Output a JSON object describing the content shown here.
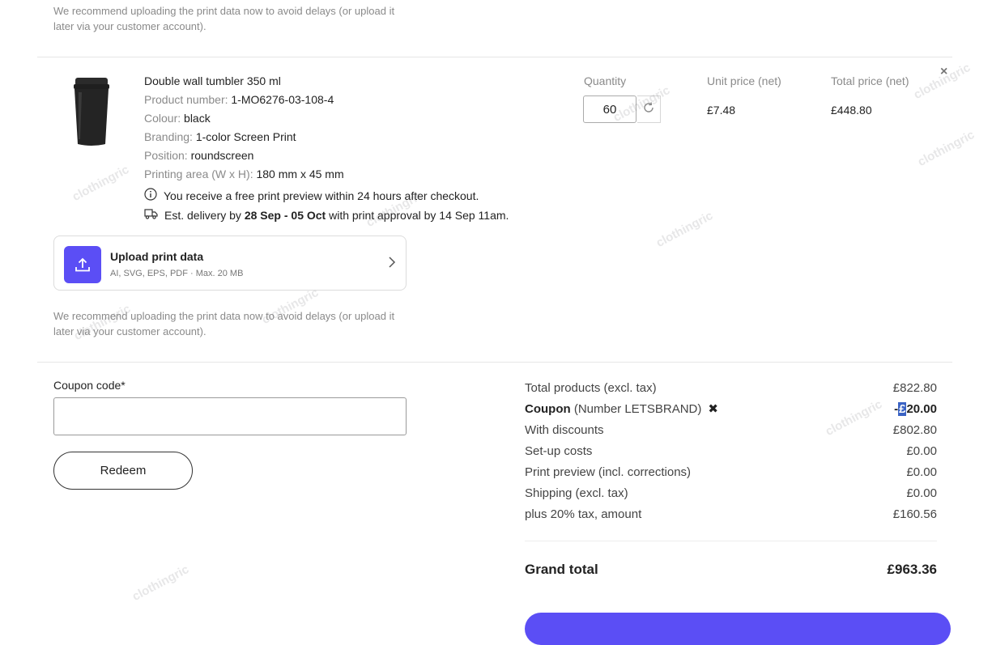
{
  "top_note": "We recommend uploading the print data now to avoid delays (or upload it later via your customer account).",
  "product": {
    "title": "Double wall tumbler 350 ml",
    "specs": [
      {
        "label": "Product number:",
        "value": "1-MO6276-03-108-4"
      },
      {
        "label": "Colour:",
        "value": "black"
      },
      {
        "label": "Branding:",
        "value": "1-color Screen Print"
      },
      {
        "label": "Position:",
        "value": "roundscreen"
      },
      {
        "label": "Printing area (W x H):",
        "value": "180 mm x 45 mm"
      }
    ],
    "preview_info": "You receive a free print preview within 24 hours after checkout.",
    "delivery": {
      "prefix": "Est. delivery by",
      "range": "28 Sep - 05 Oct",
      "suffix": "with print approval by 14 Sep 11am."
    }
  },
  "columns": {
    "quantity": "Quantity",
    "unit_price": "Unit price (net)",
    "total_price": "Total price (net)"
  },
  "line": {
    "quantity": "60",
    "unit_price": "£7.48",
    "total_price": "£448.80",
    "remove_glyph": "×"
  },
  "upload": {
    "title": "Upload print data",
    "formats": "AI, SVG, EPS, PDF · Max. 20 MB"
  },
  "bottom_note": "We recommend uploading the print data now to avoid delays (or upload it later via your customer account).",
  "coupon": {
    "label": "Coupon code*",
    "value": "",
    "redeem_label": "Redeem"
  },
  "totals": {
    "total_products_label": "Total products (excl. tax)",
    "total_products_value": "£822.80",
    "coupon_label_bold": "Coupon",
    "coupon_label_rest": " (Number LETSBRAND)",
    "coupon_remove_glyph": "✖",
    "coupon_value_sign": "-",
    "coupon_value_selected": "£",
    "coupon_value_rest": "20.00",
    "with_discounts_label": "With discounts",
    "with_discounts_value": "£802.80",
    "setup_label": "Set-up costs",
    "setup_value": "£0.00",
    "preview_label": "Print preview (incl. corrections)",
    "preview_value": "£0.00",
    "shipping_label": "Shipping (excl. tax)",
    "shipping_value": "£0.00",
    "tax_label": "plus 20% tax, amount",
    "tax_value": "£160.56",
    "grand_label": "Grand total",
    "grand_value": "£963.36"
  },
  "watermark": "clothingric",
  "colors": {
    "accent": "#5b4ef5",
    "selection": "#3b63c4"
  }
}
